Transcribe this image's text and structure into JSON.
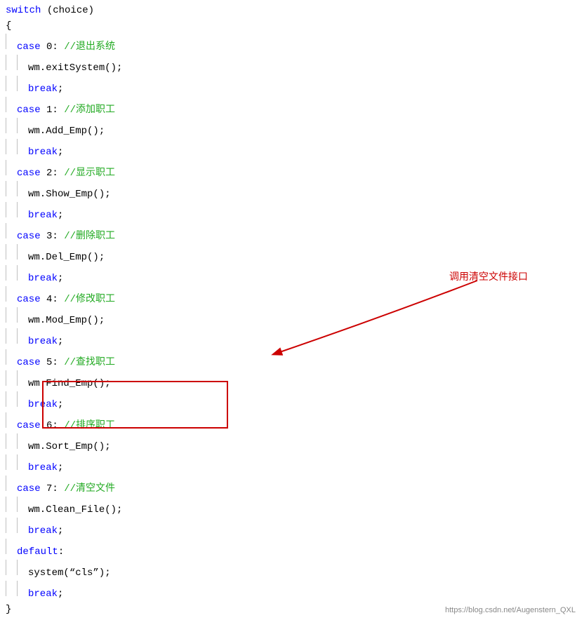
{
  "code": {
    "lines": [
      {
        "indent": 0,
        "text": "switch (choice)",
        "parts": [
          {
            "type": "kw",
            "t": "switch"
          },
          {
            "type": "plain",
            "t": " (choice)"
          }
        ]
      },
      {
        "indent": 0,
        "text": "{",
        "parts": [
          {
            "type": "plain",
            "t": "{"
          }
        ]
      },
      {
        "indent": 1,
        "text": "case 0: //退出系统",
        "parts": [
          {
            "type": "kw",
            "t": "case"
          },
          {
            "type": "plain",
            "t": " 0: "
          },
          {
            "type": "cm",
            "t": "//退出系统"
          }
        ]
      },
      {
        "indent": 2,
        "text": "wm.exitSystem();",
        "parts": [
          {
            "type": "plain",
            "t": "wm.exitSystem();"
          }
        ]
      },
      {
        "indent": 2,
        "text": "break;",
        "parts": [
          {
            "type": "kw",
            "t": "break"
          },
          {
            "type": "plain",
            "t": ";"
          }
        ]
      },
      {
        "indent": 1,
        "text": "case 1: //添加职工",
        "parts": [
          {
            "type": "kw",
            "t": "case"
          },
          {
            "type": "plain",
            "t": " 1: "
          },
          {
            "type": "cm",
            "t": "//添加职工"
          }
        ]
      },
      {
        "indent": 2,
        "text": "wm.Add_Emp();",
        "parts": [
          {
            "type": "plain",
            "t": "wm.Add_Emp();"
          }
        ]
      },
      {
        "indent": 2,
        "text": "break;",
        "parts": [
          {
            "type": "kw",
            "t": "break"
          },
          {
            "type": "plain",
            "t": ";"
          }
        ]
      },
      {
        "indent": 1,
        "text": "case 2: //显示职工",
        "parts": [
          {
            "type": "kw",
            "t": "case"
          },
          {
            "type": "plain",
            "t": " 2: "
          },
          {
            "type": "cm",
            "t": "//显示职工"
          }
        ]
      },
      {
        "indent": 2,
        "text": "wm.Show_Emp();",
        "parts": [
          {
            "type": "plain",
            "t": "wm.Show_Emp();"
          }
        ]
      },
      {
        "indent": 2,
        "text": "break;",
        "parts": [
          {
            "type": "kw",
            "t": "break"
          },
          {
            "type": "plain",
            "t": ";"
          }
        ]
      },
      {
        "indent": 1,
        "text": "case 3: //删除职工",
        "parts": [
          {
            "type": "kw",
            "t": "case"
          },
          {
            "type": "plain",
            "t": " 3: "
          },
          {
            "type": "cm",
            "t": "//删除职工"
          }
        ]
      },
      {
        "indent": 2,
        "text": "wm.Del_Emp();",
        "parts": [
          {
            "type": "plain",
            "t": "wm.Del_Emp();"
          }
        ]
      },
      {
        "indent": 2,
        "text": "break;",
        "parts": [
          {
            "type": "kw",
            "t": "break"
          },
          {
            "type": "plain",
            "t": ";"
          }
        ]
      },
      {
        "indent": 1,
        "text": "case 4: //修改职工",
        "parts": [
          {
            "type": "kw",
            "t": "case"
          },
          {
            "type": "plain",
            "t": " 4: "
          },
          {
            "type": "cm",
            "t": "//修改职工"
          }
        ]
      },
      {
        "indent": 2,
        "text": "wm.Mod_Emp();",
        "parts": [
          {
            "type": "plain",
            "t": "wm.Mod_Emp();"
          }
        ]
      },
      {
        "indent": 2,
        "text": "break;",
        "parts": [
          {
            "type": "kw",
            "t": "break"
          },
          {
            "type": "plain",
            "t": ";"
          }
        ]
      },
      {
        "indent": 1,
        "text": "case 5: //查找职工",
        "parts": [
          {
            "type": "kw",
            "t": "case"
          },
          {
            "type": "plain",
            "t": " 5: "
          },
          {
            "type": "cm",
            "t": "//查找职工"
          }
        ]
      },
      {
        "indent": 2,
        "text": "wm.Find_Emp();",
        "parts": [
          {
            "type": "plain",
            "t": "wm.Find_Emp();"
          }
        ]
      },
      {
        "indent": 2,
        "text": "break;",
        "parts": [
          {
            "type": "kw",
            "t": "break"
          },
          {
            "type": "plain",
            "t": ";"
          }
        ]
      },
      {
        "indent": 1,
        "text": "case 6: //排序职工",
        "parts": [
          {
            "type": "kw",
            "t": "case"
          },
          {
            "type": "plain",
            "t": " 6: "
          },
          {
            "type": "cm",
            "t": "//排序职工"
          }
        ]
      },
      {
        "indent": 2,
        "text": "wm.Sort_Emp();",
        "parts": [
          {
            "type": "plain",
            "t": "wm.Sort_Emp();"
          }
        ]
      },
      {
        "indent": 2,
        "text": "break;",
        "parts": [
          {
            "type": "kw",
            "t": "break"
          },
          {
            "type": "plain",
            "t": ";"
          }
        ]
      },
      {
        "indent": 1,
        "text": "case 7: //清空文件",
        "parts": [
          {
            "type": "kw",
            "t": "case"
          },
          {
            "type": "plain",
            "t": " 7: "
          },
          {
            "type": "cm",
            "t": "//清空文件"
          }
        ]
      },
      {
        "indent": 2,
        "text": "wm.Clean_File();",
        "parts": [
          {
            "type": "plain",
            "t": "wm.Clean_File();"
          }
        ]
      },
      {
        "indent": 2,
        "text": "break;",
        "parts": [
          {
            "type": "kw",
            "t": "break"
          },
          {
            "type": "plain",
            "t": ";"
          }
        ]
      },
      {
        "indent": 1,
        "text": "default:",
        "parts": [
          {
            "type": "kw",
            "t": "default"
          },
          {
            "type": "plain",
            "t": ":"
          }
        ]
      },
      {
        "indent": 2,
        "text": "system(\"cls\");",
        "parts": [
          {
            "type": "plain",
            "t": "system("
          },
          {
            "type": "plain",
            "t": "“cls”"
          },
          {
            "type": "plain",
            "t": ");"
          }
        ]
      },
      {
        "indent": 2,
        "text": "break;",
        "parts": [
          {
            "type": "kw",
            "t": "break"
          },
          {
            "type": "plain",
            "t": ";"
          }
        ]
      },
      {
        "indent": 0,
        "text": "}",
        "parts": [
          {
            "type": "plain",
            "t": "}"
          }
        ]
      }
    ],
    "annotation": "调用清空文件接口",
    "watermark": "https://blog.csdn.net/Augenstern_QXL"
  }
}
